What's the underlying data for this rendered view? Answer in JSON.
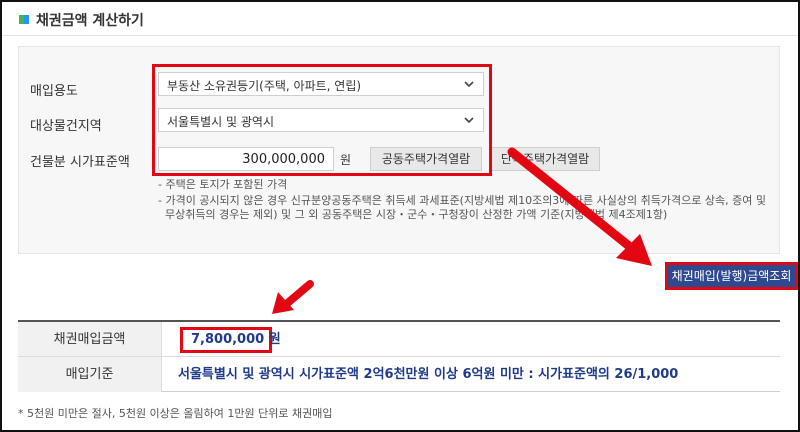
{
  "header": {
    "title": "채권금액 계산하기"
  },
  "form": {
    "usage_label": "매입용도",
    "usage_value": "부동산 소유권등기(주택, 아파트, 연립)",
    "region_label": "대상물건지역",
    "region_value": "서울특별시 및 광역시",
    "price_label": "건물분 시가표준액",
    "price_value": "300,000,000",
    "price_unit": "원",
    "btn_apartment": "공동주택가격열람",
    "btn_detached": "단독주택가격열람",
    "notes": [
      "- 주택은 토지가 포함된 가격",
      "- 가격이 공시되지 않은 경우 신규분양공동주택은 취득세 과세표준(지방세법 제10조의3에 따른 사실상의 취득가격으로 상속, 증여 및",
      "  무상취득의 경우는 제외) 및 그 외 공동주택은 시장・군수・구청장이 산정한 가액 기준(지방세법 제4조제1항)"
    ]
  },
  "action": {
    "query_label": "채권매입(발행)금액조회"
  },
  "result": {
    "amount_label": "채권매입금액",
    "amount_value": "7,800,000 원",
    "basis_label": "매입기준",
    "basis_value": "서울특별시 및 광역시 시가표준액 2억6천만원 이상 6억원 미만 : 시가표준액의 26/1,000"
  },
  "footnote": "* 5천원 미만은 절사, 5천원 이상은 올림하여 1만원 단위로 채권매입",
  "colors": {
    "accent": "#2d4a91",
    "highlight": "#e30613",
    "result_text": "#1f3a8a"
  }
}
